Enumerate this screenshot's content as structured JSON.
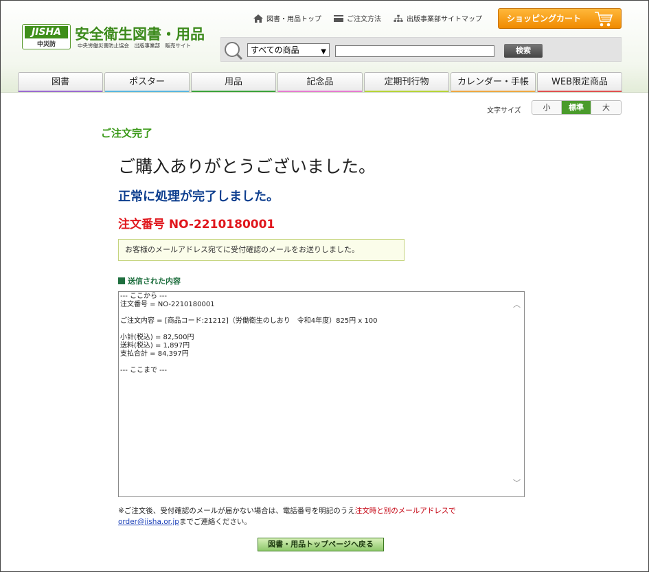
{
  "header": {
    "logo_text": "JISHA",
    "logo_sub": "中災防",
    "site_title": "安全衛生図書・用品",
    "site_subtitle": "中央労働災害防止協会　出版事業部　販売サイト",
    "top_links": [
      {
        "label": "図書・用品トップ",
        "icon": "home-icon"
      },
      {
        "label": "ご注文方法",
        "icon": "card-icon"
      },
      {
        "label": "出版事業部サイトマップ",
        "icon": "sitemap-icon"
      }
    ],
    "cart_label": "ショッピングカート",
    "search": {
      "category_selected": "すべての商品",
      "input_value": "",
      "button_label": "検索"
    },
    "nav_tabs": [
      {
        "label": "図書",
        "color": "#9a6ad0"
      },
      {
        "label": "ポスター",
        "color": "#59b6e0"
      },
      {
        "label": "用品",
        "color": "#3aa23a"
      },
      {
        "label": "記念品",
        "color": "#e67ad2"
      },
      {
        "label": "定期刊行物",
        "color": "#b7d436"
      },
      {
        "label": "カレンダー・手帳",
        "color": "#f0a640"
      },
      {
        "label": "WEB限定商品",
        "color": "#e05050"
      }
    ]
  },
  "font_size": {
    "label": "文字サイズ",
    "options": [
      "小",
      "標準",
      "大"
    ],
    "active": "標準"
  },
  "content": {
    "section_title": "ご注文完了",
    "thanks": "ご購入ありがとうございました。",
    "done_message": "正常に処理が完了しました。",
    "order_number": "注文番号 NO-2210180001",
    "mail_note": "お客様のメールアドレス宛てに受付確認のメールをお送りしました。",
    "sent_title": "送信された内容",
    "sent_body": "--- ここから ---\n注文番号 = NO-2210180001\n\nご注文内容 = [商品コード:21212]（労働衛生のしおり　令和4年度）825円 x 100\n\n小計(税込) = 82,500円\n送料(税込) = 1,897円\n支払合計 = 84,397円\n\n--- ここまで ---",
    "footnote_part1": "※ご注文後、受付確認のメールが届かない場合は、電話番号を明記のうえ",
    "footnote_red": "注文時と別のメールアドレスで",
    "footnote_email": "order@jisha.or.jp",
    "footnote_part2": "までご連絡ください。",
    "back_button": "図書・用品トップページへ戻る"
  }
}
